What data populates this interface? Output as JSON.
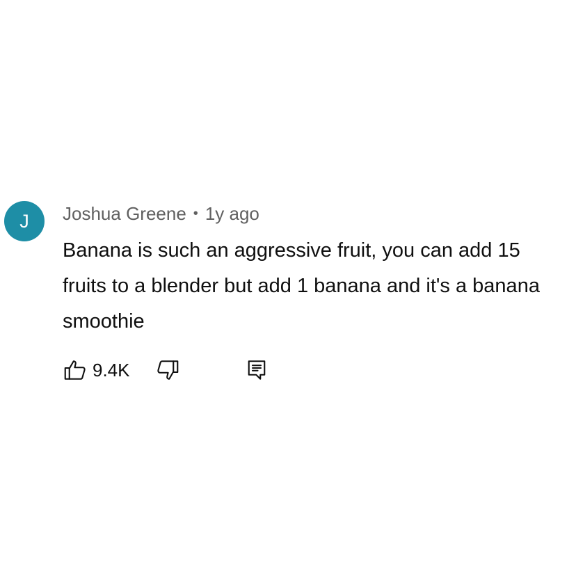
{
  "comment": {
    "avatar_letter": "J",
    "avatar_color": "#1e8ea6",
    "author": "Joshua Greene",
    "separator": "•",
    "time_ago": "1y ago",
    "text": "Banana is such an aggressive fruit, you can add 15 fruits to a blender but add 1 banana and it's a banana smoothie",
    "like_count": "9.4K",
    "icons": {
      "like": "thumbs-up-icon",
      "dislike": "thumbs-down-icon",
      "reply": "reply-comment-icon"
    }
  }
}
